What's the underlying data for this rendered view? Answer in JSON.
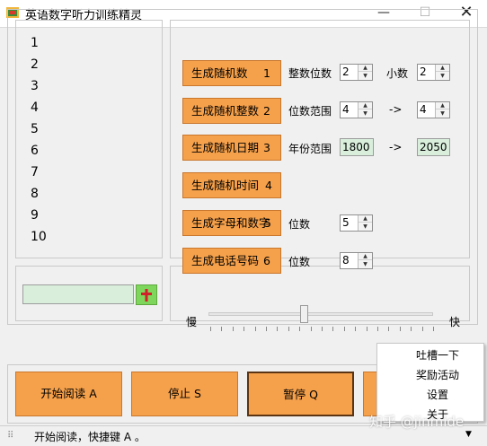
{
  "window": {
    "title": "英语数字听力训练精灵",
    "minimize": "—",
    "maximize": "☐",
    "close": "✕"
  },
  "number_list": [
    "1",
    "2",
    "3",
    "4",
    "5",
    "6",
    "7",
    "8",
    "9",
    "10"
  ],
  "generators": [
    {
      "label": "生成随机数",
      "key": "1"
    },
    {
      "label": "生成随机整数",
      "key": "2"
    },
    {
      "label": "生成随机日期",
      "key": "3"
    },
    {
      "label": "生成随机时间",
      "key": "4"
    },
    {
      "label": "生成字母和数字",
      "key": "5"
    },
    {
      "label": "生成电话号码",
      "key": "6"
    }
  ],
  "options": {
    "integer_digits_label": "整数位数",
    "integer_digits": "2",
    "decimal_label": "小数",
    "decimal_digits": "2",
    "digit_range_label": "位数范围",
    "digit_range_from": "4",
    "digit_range_arrow": "->",
    "digit_range_to": "4",
    "year_range_label": "年份范围",
    "year_from": "1800",
    "year_arrow": "->",
    "year_to": "2050",
    "alnum_digits_label": "位数",
    "alnum_digits": "5",
    "phone_digits_label": "位数",
    "phone_digits": "8"
  },
  "input_box": {
    "value": "",
    "cross_icon": "cross-icon"
  },
  "speed": {
    "slow_label": "慢",
    "fast_label": "快",
    "level": 0.42
  },
  "controls": {
    "start_label": "开始阅读 A",
    "stop_label": "停止 S",
    "pause_label": "暂停 Q",
    "more_label": ""
  },
  "status": {
    "text": "开始阅读，快捷键 A 。",
    "grip": "⠿",
    "dropdown": "▼"
  },
  "popup_menu": {
    "items": [
      "吐槽一下",
      "奖励活动",
      "设置",
      "关于"
    ]
  },
  "watermark": "知乎 @jinmide",
  "colors": {
    "button_orange": "#f5a04a",
    "field_green": "#d9efdc",
    "cross_green": "#7fd65c",
    "cross_red": "#d0202a"
  }
}
